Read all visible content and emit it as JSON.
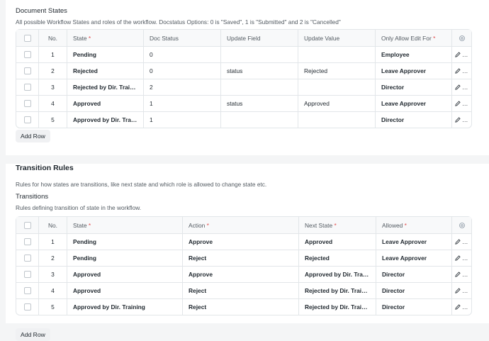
{
  "document_states": {
    "label": "Document States",
    "description": "All possible Workflow States and roles of the workflow. Docstatus Options: 0 is \"Saved\", 1 is \"Submitted\" and 2 is \"Cancelled\"",
    "columns": {
      "no": "No.",
      "state": "State",
      "doc_status": "Doc Status",
      "update_field": "Update Field",
      "update_value": "Update Value",
      "only_allow_edit_for": "Only Allow Edit For"
    },
    "rows": [
      {
        "no": "1",
        "state": "Pending",
        "doc_status": "0",
        "update_field": "",
        "update_value": "",
        "role": "Employee",
        "edit": "Edit"
      },
      {
        "no": "2",
        "state": "Rejected",
        "doc_status": "0",
        "update_field": "status",
        "update_value": "Rejected",
        "role": "Leave Approver",
        "edit": "Edit"
      },
      {
        "no": "3",
        "state": "Rejected by Dir. Training",
        "doc_status": "2",
        "update_field": "",
        "update_value": "",
        "role": "Director",
        "edit": "Edit"
      },
      {
        "no": "4",
        "state": "Approved",
        "doc_status": "1",
        "update_field": "status",
        "update_value": "Approved",
        "role": "Leave Approver",
        "edit": "Edit"
      },
      {
        "no": "5",
        "state": "Approved by Dir. Traini...",
        "doc_status": "1",
        "update_field": "",
        "update_value": "",
        "role": "Director",
        "edit": "Edit"
      }
    ],
    "add_row": "Add Row"
  },
  "transition_rules": {
    "title": "Transition Rules",
    "description": "Rules for how states are transitions, like next state and which role is allowed to change state etc.",
    "sub_label": "Transitions",
    "sub_description": "Rules defining transition of state in the workflow.",
    "columns": {
      "no": "No.",
      "state": "State",
      "action": "Action",
      "next_state": "Next State",
      "allowed": "Allowed"
    },
    "rows": [
      {
        "no": "1",
        "state": "Pending",
        "action": "Approve",
        "next_state": "Approved",
        "allowed": "Leave Approver",
        "edit": "Edit"
      },
      {
        "no": "2",
        "state": "Pending",
        "action": "Reject",
        "next_state": "Rejected",
        "allowed": "Leave Approver",
        "edit": "Edit"
      },
      {
        "no": "3",
        "state": "Approved",
        "action": "Approve",
        "next_state": "Approved by Dir. Traini...",
        "allowed": "Director",
        "edit": "Edit"
      },
      {
        "no": "4",
        "state": "Approved",
        "action": "Reject",
        "next_state": "Rejected by Dir. Training",
        "allowed": "Director",
        "edit": "Edit"
      },
      {
        "no": "5",
        "state": "Approved by Dir. Training",
        "action": "Reject",
        "next_state": "Rejected by Dir. Training",
        "allowed": "Director",
        "edit": "Edit"
      }
    ],
    "add_row": "Add Row"
  },
  "required_marker": "*",
  "icons": {
    "settings": "gear-icon",
    "edit": "pencil-icon"
  }
}
